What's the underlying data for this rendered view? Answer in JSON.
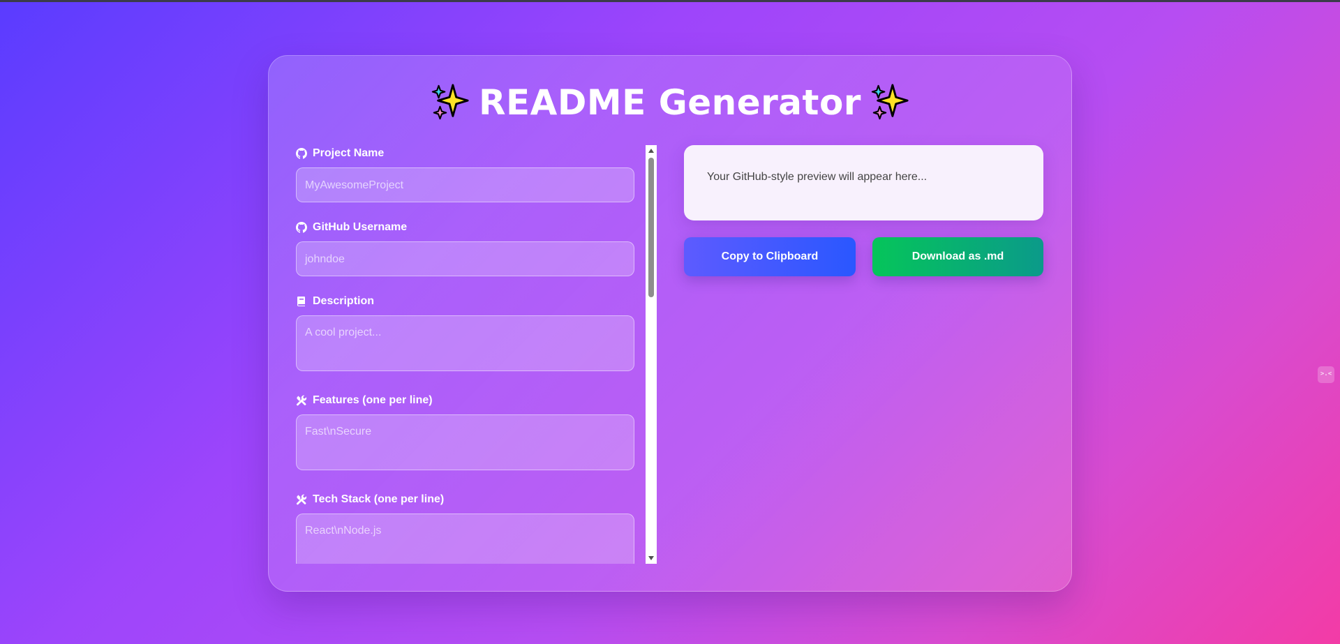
{
  "header": {
    "title": "README Generator"
  },
  "form": {
    "fields": [
      {
        "label": "Project Name",
        "icon": "github-icon",
        "placeholder": "MyAwesomeProject",
        "value": ""
      },
      {
        "label": "GitHub Username",
        "icon": "github-icon",
        "placeholder": "johndoe",
        "value": ""
      },
      {
        "label": "Description",
        "icon": "book-icon",
        "placeholder": "A cool project...",
        "value": ""
      },
      {
        "label": "Features (one per line)",
        "icon": "tools-icon",
        "placeholder": "Fast\\nSecure",
        "value": ""
      },
      {
        "label": "Tech Stack (one per line)",
        "icon": "tools-icon",
        "placeholder": "React\\nNode.js",
        "value": ""
      }
    ]
  },
  "preview": {
    "placeholder_text": "Your GitHub-style preview will appear here..."
  },
  "actions": {
    "copy_label": "Copy to Clipboard",
    "download_label": "Download as .md"
  },
  "side_tab": {
    "text": ">.<"
  },
  "colors": {
    "bg_start": "#5a3cff",
    "bg_end": "#f33ba6",
    "copy_button": "#2a57ff",
    "download_button": "#05c55a",
    "preview_bg": "#f8f1fd"
  }
}
